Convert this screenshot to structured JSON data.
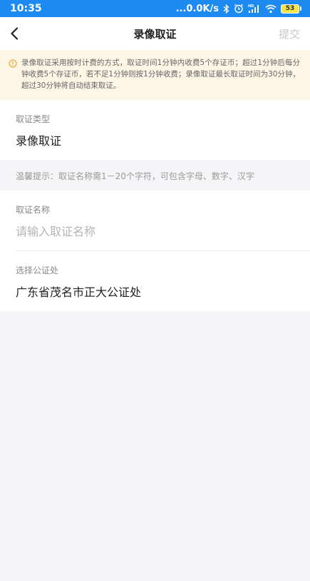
{
  "status_bar": {
    "time": "10:35",
    "net_speed": "...0.0K/s",
    "battery": "53",
    "icons": [
      "bluetooth-icon",
      "alarm-icon",
      "signal-icon",
      "wifi-icon",
      "battery-icon"
    ],
    "hd_label": "HD"
  },
  "nav": {
    "title": "录像取证",
    "submit_label": "提交",
    "back_icon": "chevron-left-icon"
  },
  "notice": {
    "icon": "info-circle-icon",
    "text": "录像取证采用按时计费的方式，取证时间1分钟内收费5个存证币；超过1分钟后每分钟收费5个存证币，若不足1分钟则按1分钟收费；录像取证最长取证时间为30分钟，超过30分钟将自动结束取证。"
  },
  "type_field": {
    "label": "取证类型",
    "value": "录像取证"
  },
  "tip": "温馨提示：取证名称需1－20个字符，可包含字母、数字、汉字",
  "name_field": {
    "label": "取证名称",
    "placeholder": "请输入取证名称"
  },
  "notary_field": {
    "label": "选择公证处",
    "value": "广东省茂名市正大公证处"
  },
  "colors": {
    "status_bar": "#1c8af0",
    "notice_bg": "#fdf6e6",
    "notice_icon": "#f0a020",
    "page_bg": "#f5f5f7"
  }
}
